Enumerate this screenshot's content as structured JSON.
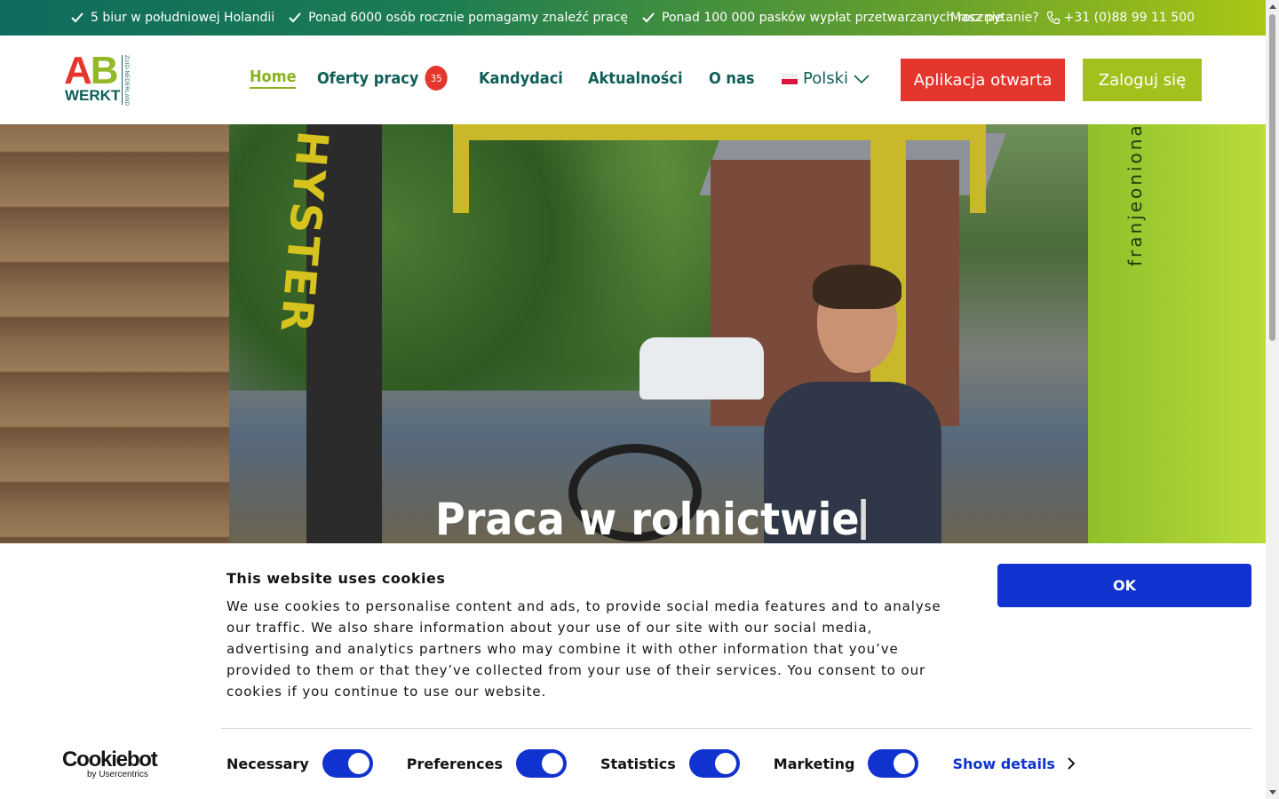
{
  "topbar": {
    "usps": [
      "5 biur w południowej Holandii",
      "Ponad 6000 osób rocznie pomagamy znaleźć pracę",
      "Ponad 100 000 pasków wypłat przetwarzanych rocznie"
    ],
    "question_label": "Masz pytanie?",
    "phone": "+31 (0)88 99 11 500"
  },
  "logo": {
    "a": "A",
    "b": "B",
    "werkt": "WERKT",
    "region": "ZUID-NEDERLAND"
  },
  "nav": {
    "items": [
      "Home",
      "Oferty pracy",
      "Kandydaci",
      "Aktualności",
      "O nas"
    ],
    "jobs_count": "35"
  },
  "language": {
    "selected": "Polski"
  },
  "buttons": {
    "open_application": "Aplikacja otwarta",
    "login": "Zaloguj się"
  },
  "hero": {
    "title": "Praca w rolnictwie",
    "mast_text": "HYSTER",
    "truck_text": "franjeoniona"
  },
  "cookie": {
    "title": "This website uses cookies",
    "text": "We use cookies to personalise content and ads, to provide social media features and to analyse our traffic. We also share information about your use of our site with our social media, advertising and analytics partners who may combine it with other information that you’ve provided to them or that they’ve collected from your use of their services. You consent to our cookies if you continue to use our website.",
    "ok_label": "OK",
    "toggles": [
      {
        "label": "Necessary",
        "checked": true
      },
      {
        "label": "Preferences",
        "checked": true
      },
      {
        "label": "Statistics",
        "checked": true
      },
      {
        "label": "Marketing",
        "checked": true
      }
    ],
    "show_details": "Show details",
    "brand": "Cookiebot",
    "brand_sub": "by Usercentrics"
  },
  "colors": {
    "brand_green_dark": "#0f5e58",
    "brand_lime": "#a3c11c",
    "brand_red": "#e4362c",
    "cookie_blue": "#1032cf"
  }
}
